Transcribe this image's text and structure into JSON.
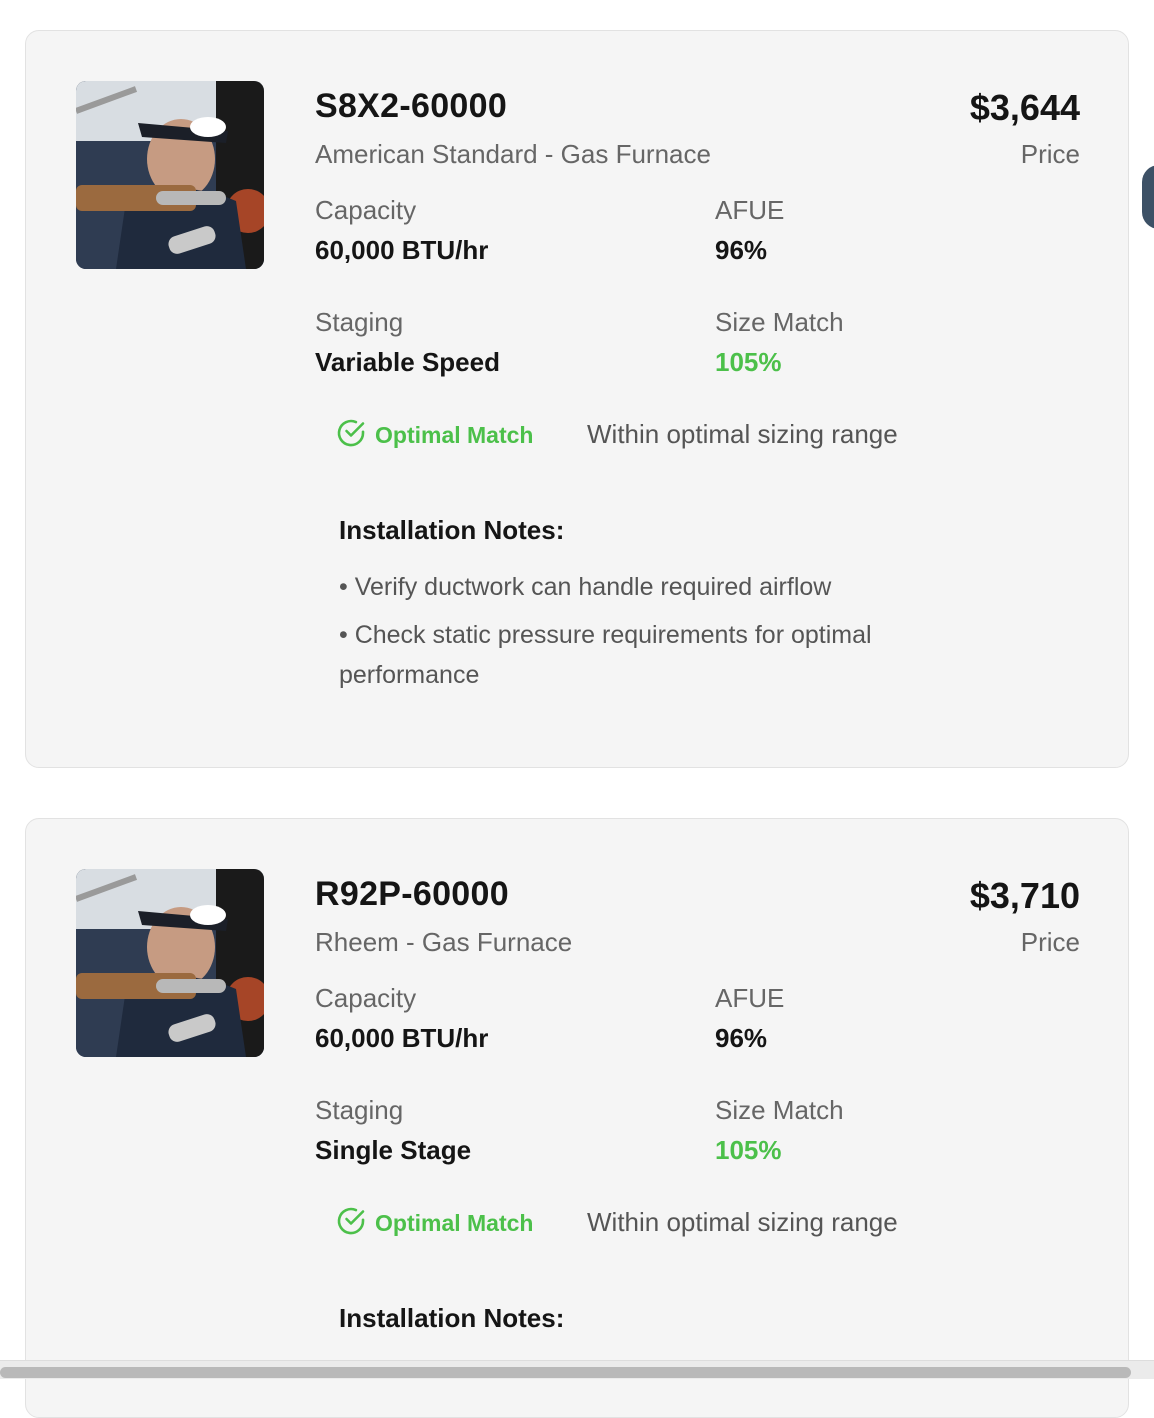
{
  "products": [
    {
      "model": "S8X2-60000",
      "brand": "American Standard - Gas Furnace",
      "price": "$3,644",
      "price_label": "Price",
      "capacity_label": "Capacity",
      "capacity": "60,000 BTU/hr",
      "afue_label": "AFUE",
      "afue": "96%",
      "staging_label": "Staging",
      "staging": "Variable Speed",
      "size_match_label": "Size Match",
      "size_match": "105%",
      "match_badge": "Optimal Match",
      "match_description": "Within optimal sizing range",
      "notes_title": "Installation Notes:",
      "notes": [
        "• Verify ductwork can handle required airflow",
        "• Check static pressure requirements for optimal performance"
      ]
    },
    {
      "model": "R92P-60000",
      "brand": "Rheem - Gas Furnace",
      "price": "$3,710",
      "price_label": "Price",
      "capacity_label": "Capacity",
      "capacity": "60,000 BTU/hr",
      "afue_label": "AFUE",
      "afue": "96%",
      "staging_label": "Staging",
      "staging": "Single Stage",
      "size_match_label": "Size Match",
      "size_match": "105%",
      "match_badge": "Optimal Match",
      "match_description": "Within optimal sizing range",
      "notes_title": "Installation Notes:"
    }
  ],
  "colors": {
    "accent_green": "#4cc04a",
    "card_background": "#f5f5f5",
    "side_tab": "#3d5166"
  }
}
